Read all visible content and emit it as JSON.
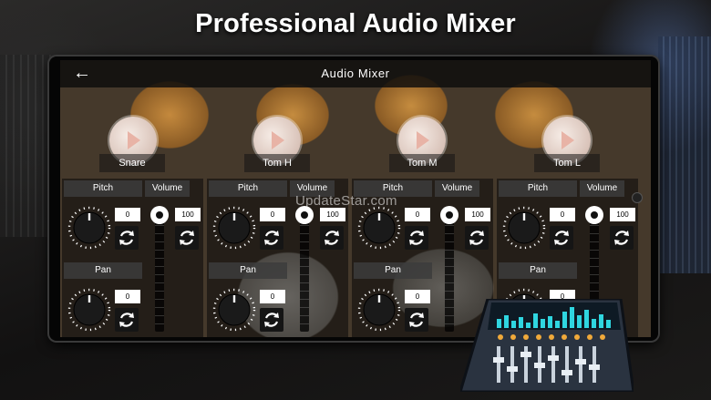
{
  "promo": {
    "headline": "Professional Audio Mixer"
  },
  "app": {
    "title": "Audio Mixer",
    "back_icon": "arrow-back-icon"
  },
  "watermark": "UpdateStar.com",
  "channels": [
    {
      "name": "Snare",
      "pitch_label": "Pitch",
      "volume_label": "Volume",
      "pan_label": "Pan",
      "pitch_value": "0",
      "volume_value": "100",
      "pan_value": "0"
    },
    {
      "name": "Tom H",
      "pitch_label": "Pitch",
      "volume_label": "Volume",
      "pan_label": "Pan",
      "pitch_value": "0",
      "volume_value": "100",
      "pan_value": "0"
    },
    {
      "name": "Tom M",
      "pitch_label": "Pitch",
      "volume_label": "Volume",
      "pan_label": "Pan",
      "pitch_value": "0",
      "volume_value": "100",
      "pan_value": "0"
    },
    {
      "name": "Tom L",
      "pitch_label": "Pitch",
      "volume_label": "Volume",
      "pan_label": "Pan",
      "pitch_value": "0",
      "volume_value": "100",
      "pan_value": "0"
    }
  ],
  "colors": {
    "accent_white": "#ffffff",
    "panel": "#3c3c3c",
    "drum_wood": "#c58c3f",
    "mixer_icon": "#2fd6e0"
  }
}
